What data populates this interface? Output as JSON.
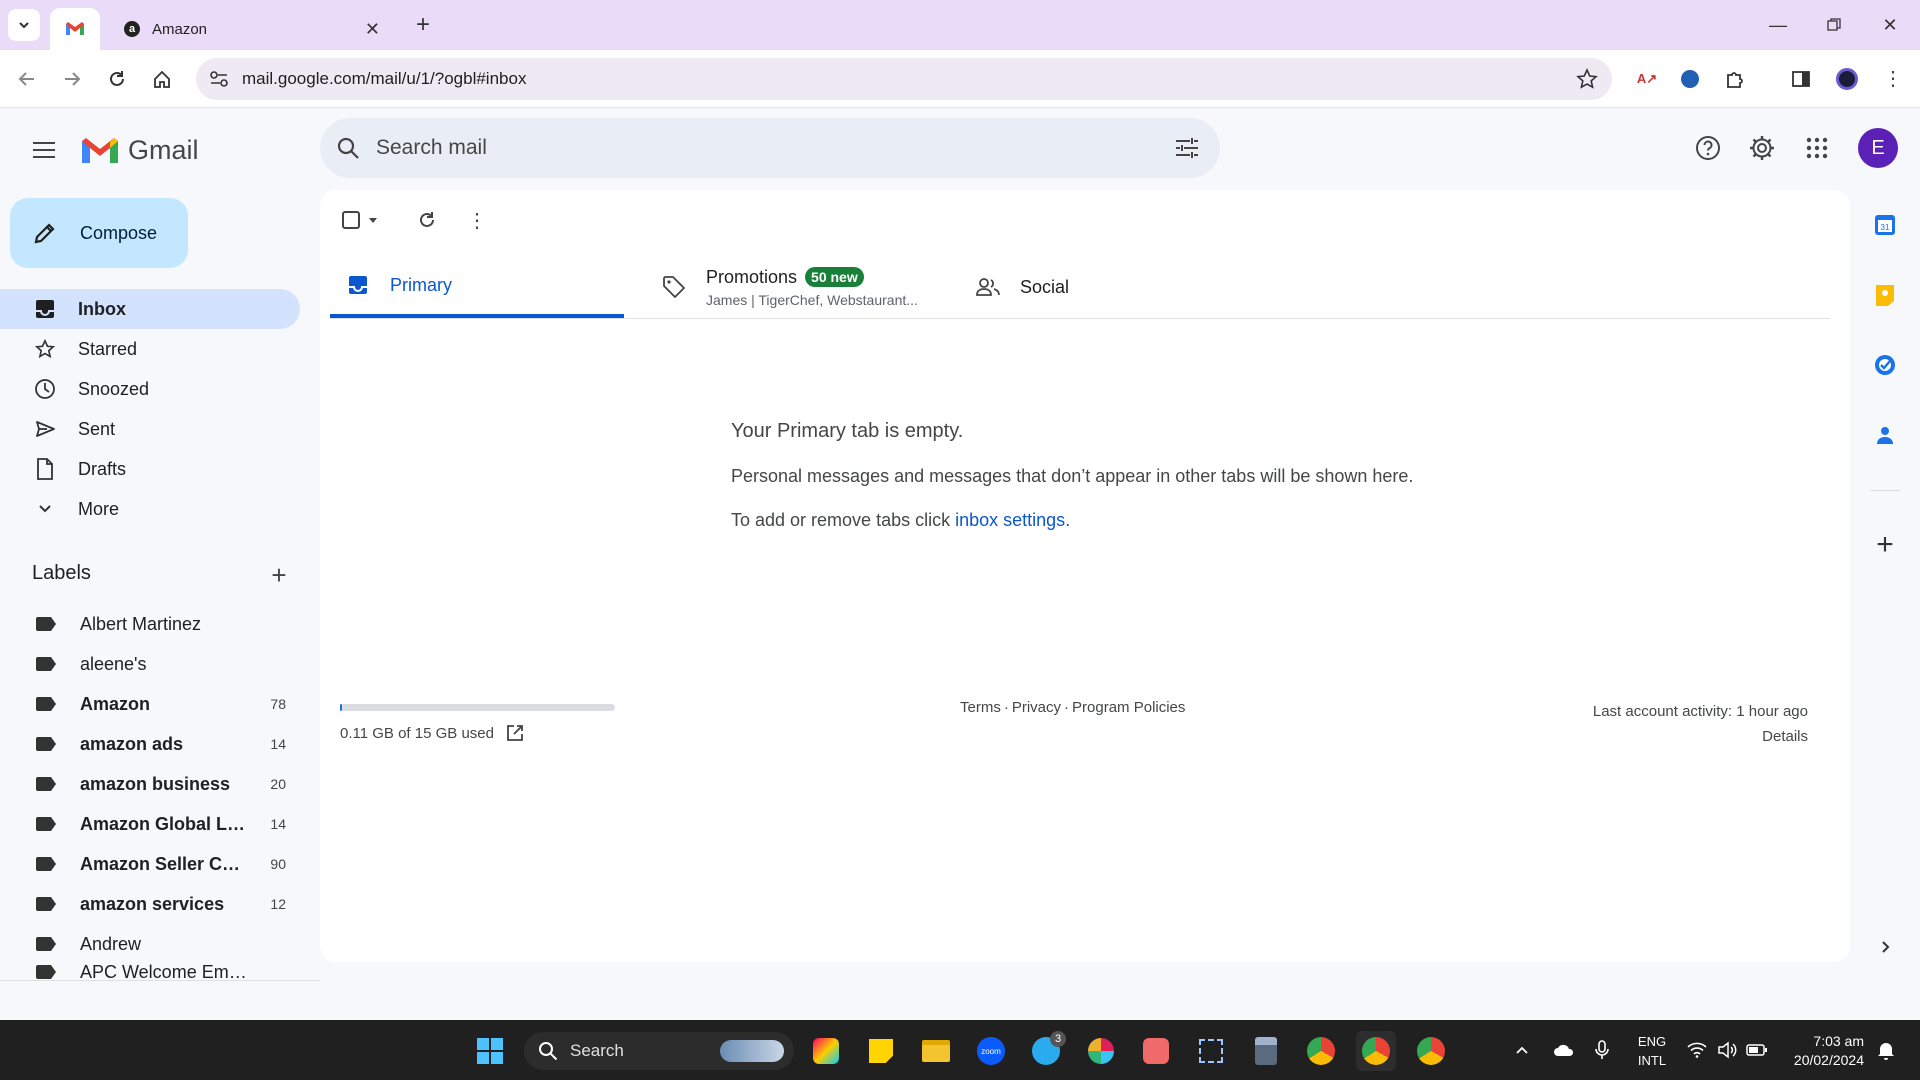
{
  "browser": {
    "tabs": [
      {
        "title": "",
        "icon": "gmail-icon",
        "active": true
      },
      {
        "title": "Amazon",
        "icon": "amazon-icon",
        "active": false
      }
    ],
    "url": "mail.google.com/mail/u/1/?ogbl#inbox"
  },
  "gmail": {
    "logo_text": "Gmail",
    "search_placeholder": "Search mail",
    "avatar_letter": "E",
    "compose_label": "Compose",
    "nav": [
      {
        "label": "Inbox",
        "icon": "inbox-icon",
        "active": true
      },
      {
        "label": "Starred",
        "icon": "star-icon",
        "active": false
      },
      {
        "label": "Snoozed",
        "icon": "clock-icon",
        "active": false
      },
      {
        "label": "Sent",
        "icon": "send-icon",
        "active": false
      },
      {
        "label": "Drafts",
        "icon": "draft-icon",
        "active": false
      },
      {
        "label": "More",
        "icon": "chevron-down-icon",
        "active": false
      }
    ],
    "labels_title": "Labels",
    "labels": [
      {
        "name": "Albert Martinez",
        "count": "",
        "bold": false
      },
      {
        "name": "aleene's",
        "count": "",
        "bold": false
      },
      {
        "name": "Amazon",
        "count": "78",
        "bold": true
      },
      {
        "name": "amazon ads",
        "count": "14",
        "bold": true
      },
      {
        "name": "amazon business",
        "count": "20",
        "bold": true
      },
      {
        "name": "Amazon Global Lo...",
        "count": "14",
        "bold": true
      },
      {
        "name": "Amazon Seller Ce...",
        "count": "90",
        "bold": true
      },
      {
        "name": "amazon services",
        "count": "12",
        "bold": true
      },
      {
        "name": "Andrew",
        "count": "",
        "bold": false
      },
      {
        "name": "APC Welcome Emails",
        "count": "",
        "bold": false
      }
    ],
    "tabs": {
      "primary": "Primary",
      "promotions": "Promotions",
      "promotions_badge": "50 new",
      "promotions_sub": "James | TigerChef, Webstaurant...",
      "social": "Social"
    },
    "empty": {
      "title": "Your Primary tab is empty.",
      "desc": "Personal messages and messages that don’t appear in other tabs will be shown here.",
      "tabs_prefix": "To add or remove tabs click ",
      "tabs_link": "inbox settings",
      "tabs_suffix": "."
    },
    "footer": {
      "storage": "0.11 GB of 15 GB used",
      "storage_fraction": 0.007,
      "terms": "Terms",
      "privacy": "Privacy",
      "policies": "Program Policies",
      "sep": "·",
      "activity": "Last account activity: 1 hour ago",
      "details": "Details"
    }
  },
  "taskbar": {
    "search_label": "Search",
    "lang_top": "ENG",
    "lang_bottom": "INTL",
    "time": "7:03 am",
    "date": "20/02/2024",
    "telegram_badge": "3"
  },
  "colors": {
    "accent": "#0b57d0",
    "compose_bg": "#c2e7ff",
    "active_nav": "#d3e3fd",
    "badge_green": "#188038",
    "tabstrip": "#eadcf8"
  }
}
